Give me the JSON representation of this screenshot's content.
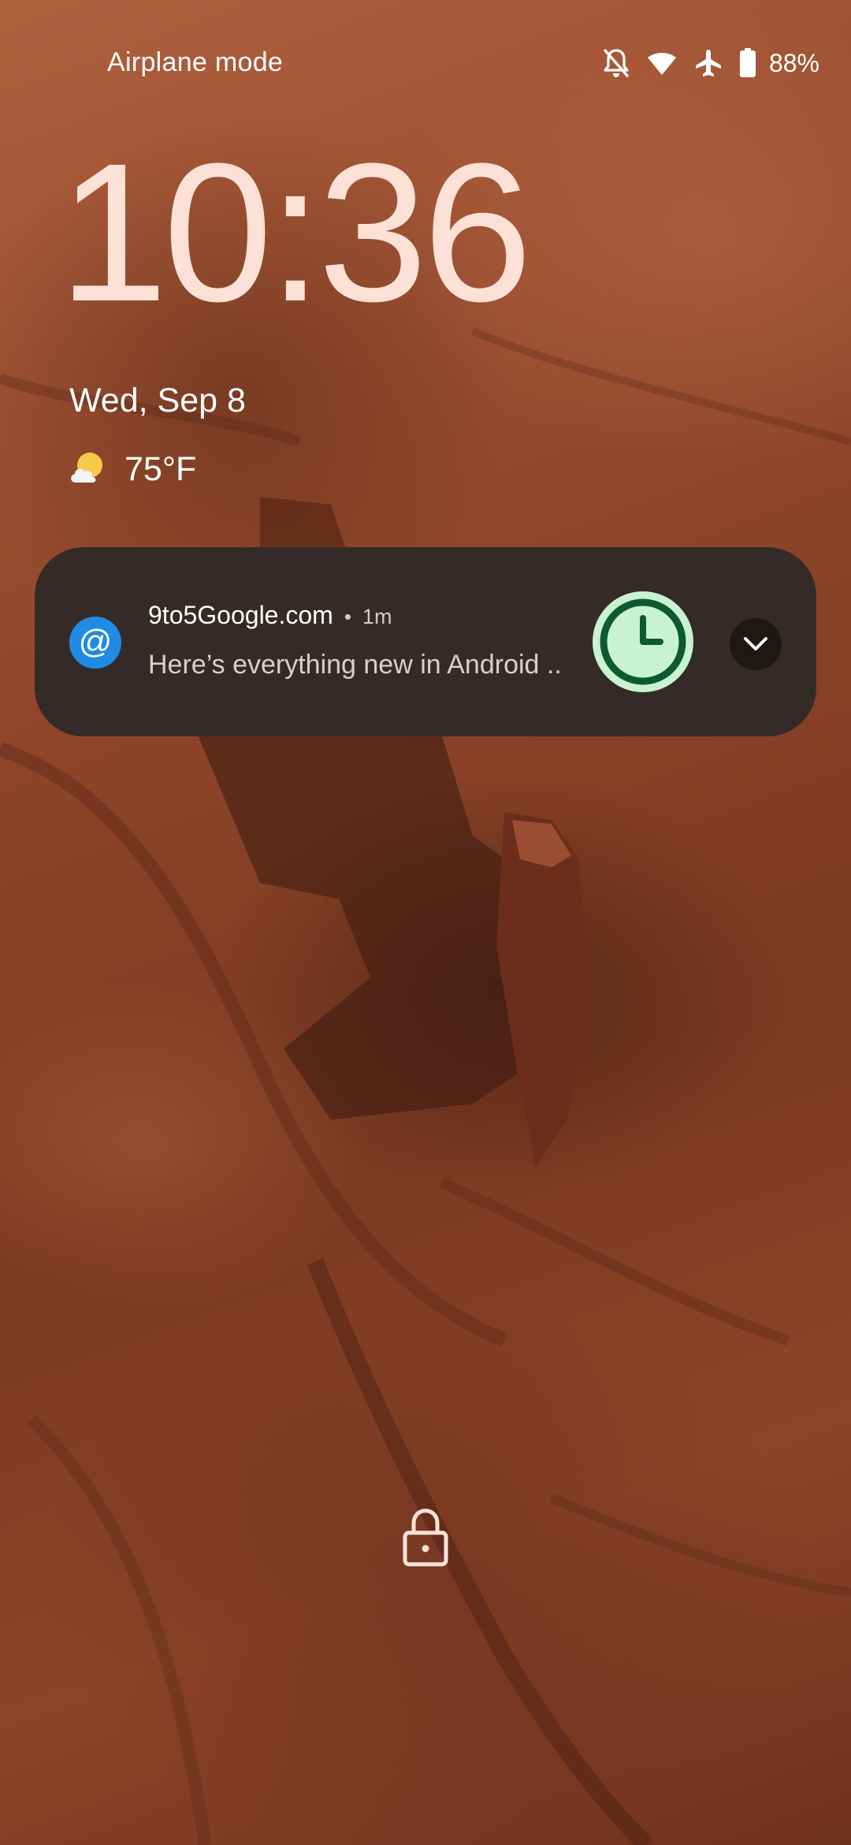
{
  "status_bar": {
    "carrier_text": "Airplane mode",
    "icons": [
      "notifications-off-icon",
      "wifi-icon",
      "airplane-icon",
      "battery-icon"
    ],
    "battery_percent": "88%"
  },
  "lockscreen": {
    "time": "10:36",
    "date": "Wed, Sep 8",
    "weather": {
      "icon": "partly-cloudy-icon",
      "temperature": "75°F"
    },
    "lock_icon": "lock-icon"
  },
  "notification": {
    "app_icon": "at-sign-icon",
    "app_icon_glyph": "@",
    "source": "9to5Google.com",
    "separator": "•",
    "time": "1m",
    "text": "Here’s everything new in Android ..",
    "thumbnail_icon": "clock-icon",
    "expand_icon": "chevron-down-icon"
  },
  "colors": {
    "clock_text": "#fde1d6",
    "notification_bg": "#342b29",
    "app_icon_bg": "#1f8be5",
    "thumbnail_bg": "#c8f2d0",
    "thumbnail_ring": "#0e5a2e"
  }
}
